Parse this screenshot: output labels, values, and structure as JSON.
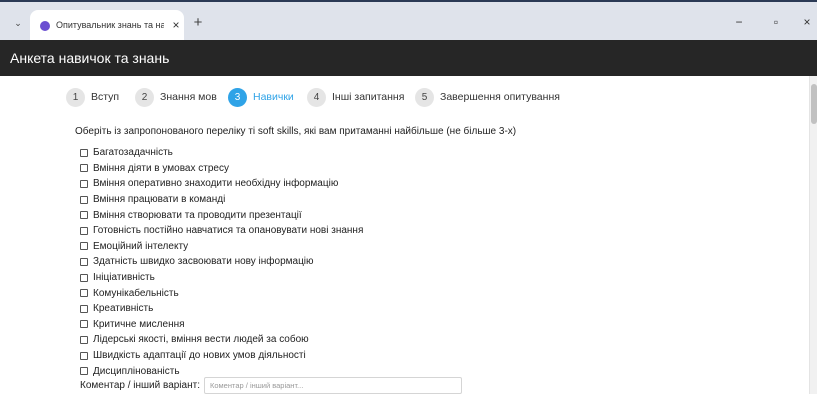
{
  "browser": {
    "tab_title": "Опитувальник знань та навич",
    "tab_close": "×",
    "new_tab": "+",
    "menu_glyph": "⌄",
    "window_controls": {
      "minimize": "−",
      "maximize": "▫",
      "close": "×"
    }
  },
  "header": {
    "title": "Анкета навичок та знань"
  },
  "steps": [
    {
      "number": "1",
      "label": "Вступ",
      "active": false
    },
    {
      "number": "2",
      "label": "Знання мов",
      "active": false
    },
    {
      "number": "3",
      "label": "Навички",
      "active": true
    },
    {
      "number": "4",
      "label": "Інші запитання",
      "active": false
    },
    {
      "number": "5",
      "label": "Завершення опитування",
      "active": false
    }
  ],
  "question": {
    "text": "Оберіть із запропонованого переліку ті soft skills, які вам притаманні найбільше (не більше 3-х)"
  },
  "options": [
    "Багатозадачність",
    "Вміння діяти в умовах стресу",
    "Вміння оперативно знаходити необхідну інформацію",
    "Вміння працювати в команді",
    "Вміння створювати та проводити презентації",
    "Готовність постійно навчатися та опановувати нові знання",
    "Емоційний інтелекту",
    "Здатність швидко засвоювати нову інформацію",
    "Ініціативність",
    "Комунікабельність",
    "Креативність",
    "Критичне мислення",
    "Лідерські якості, вміння вести людей за собою",
    "Швидкість адаптації до нових умов діяльності",
    "Дисциплінованість"
  ],
  "comment": {
    "label": "Коментар / інший варіант:",
    "placeholder": "Коментар / інший варіант...",
    "value": ""
  },
  "colors": {
    "accent": "#2fa3e7",
    "header_bg": "#262626",
    "tabbar_bg": "#dfe3eb"
  }
}
